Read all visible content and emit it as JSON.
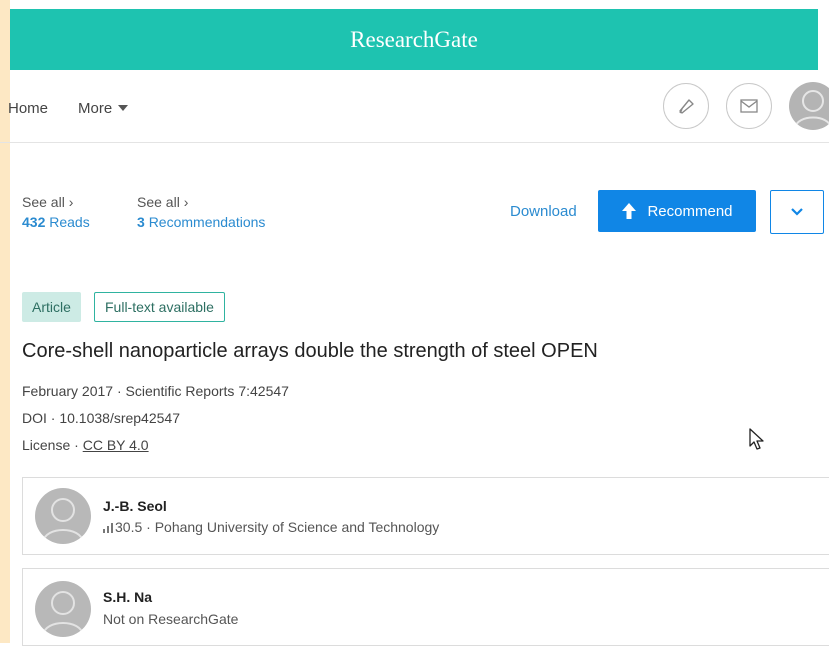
{
  "app": {
    "brand": "ResearchGate"
  },
  "nav": {
    "home": "Home",
    "more": "More",
    "icons": [
      "bell-icon",
      "mail-icon",
      "user-avatar"
    ]
  },
  "stats": {
    "reads": {
      "see_all": "See all ›",
      "count": "432",
      "label": "Reads"
    },
    "recommendations": {
      "see_all": "See all ›",
      "count": "3",
      "label": "Recommendations"
    }
  },
  "actions": {
    "download": "Download",
    "recommend": "Recommend"
  },
  "article": {
    "type_badge": "Article",
    "availability_badge": "Full-text available",
    "title": "Core-shell nanoparticle arrays double the strength of steel OPEN",
    "date_journal": "February 2017 · Scientific Reports 7:42547",
    "doi": "DOI · 10.1038/srep42547",
    "license_prefix": "License · ",
    "license": "CC BY 4.0"
  },
  "authors": [
    {
      "name": "J.-B. Seol",
      "score": "30.5",
      "affiliation": " · Pohang University of Science and Technology"
    },
    {
      "name": "S.H. Na",
      "status": "Not on ResearchGate"
    }
  ],
  "colors": {
    "brand": "#1ec3b0",
    "primary": "#1086e6",
    "link": "#2b8bd0"
  }
}
